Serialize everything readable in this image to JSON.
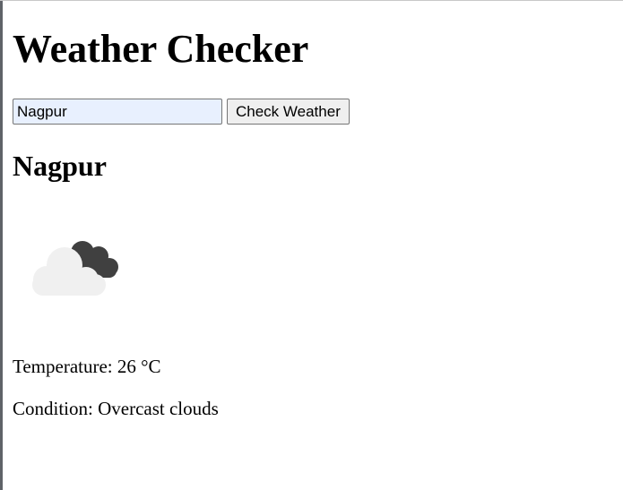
{
  "page": {
    "title": "Weather Checker"
  },
  "search": {
    "value": "Nagpur",
    "button_label": "Check Weather"
  },
  "result": {
    "city": "Nagpur",
    "icon": "overcast-clouds-icon",
    "temperature_label": "Temperature:",
    "temperature_value": "26 °C",
    "condition_label": "Condition:",
    "condition_value": "Overcast clouds"
  },
  "colors": {
    "input_background": "#e8f0fe",
    "button_background": "#efefef",
    "cloud_light": "#f0f0f0",
    "cloud_dark": "#404040"
  }
}
